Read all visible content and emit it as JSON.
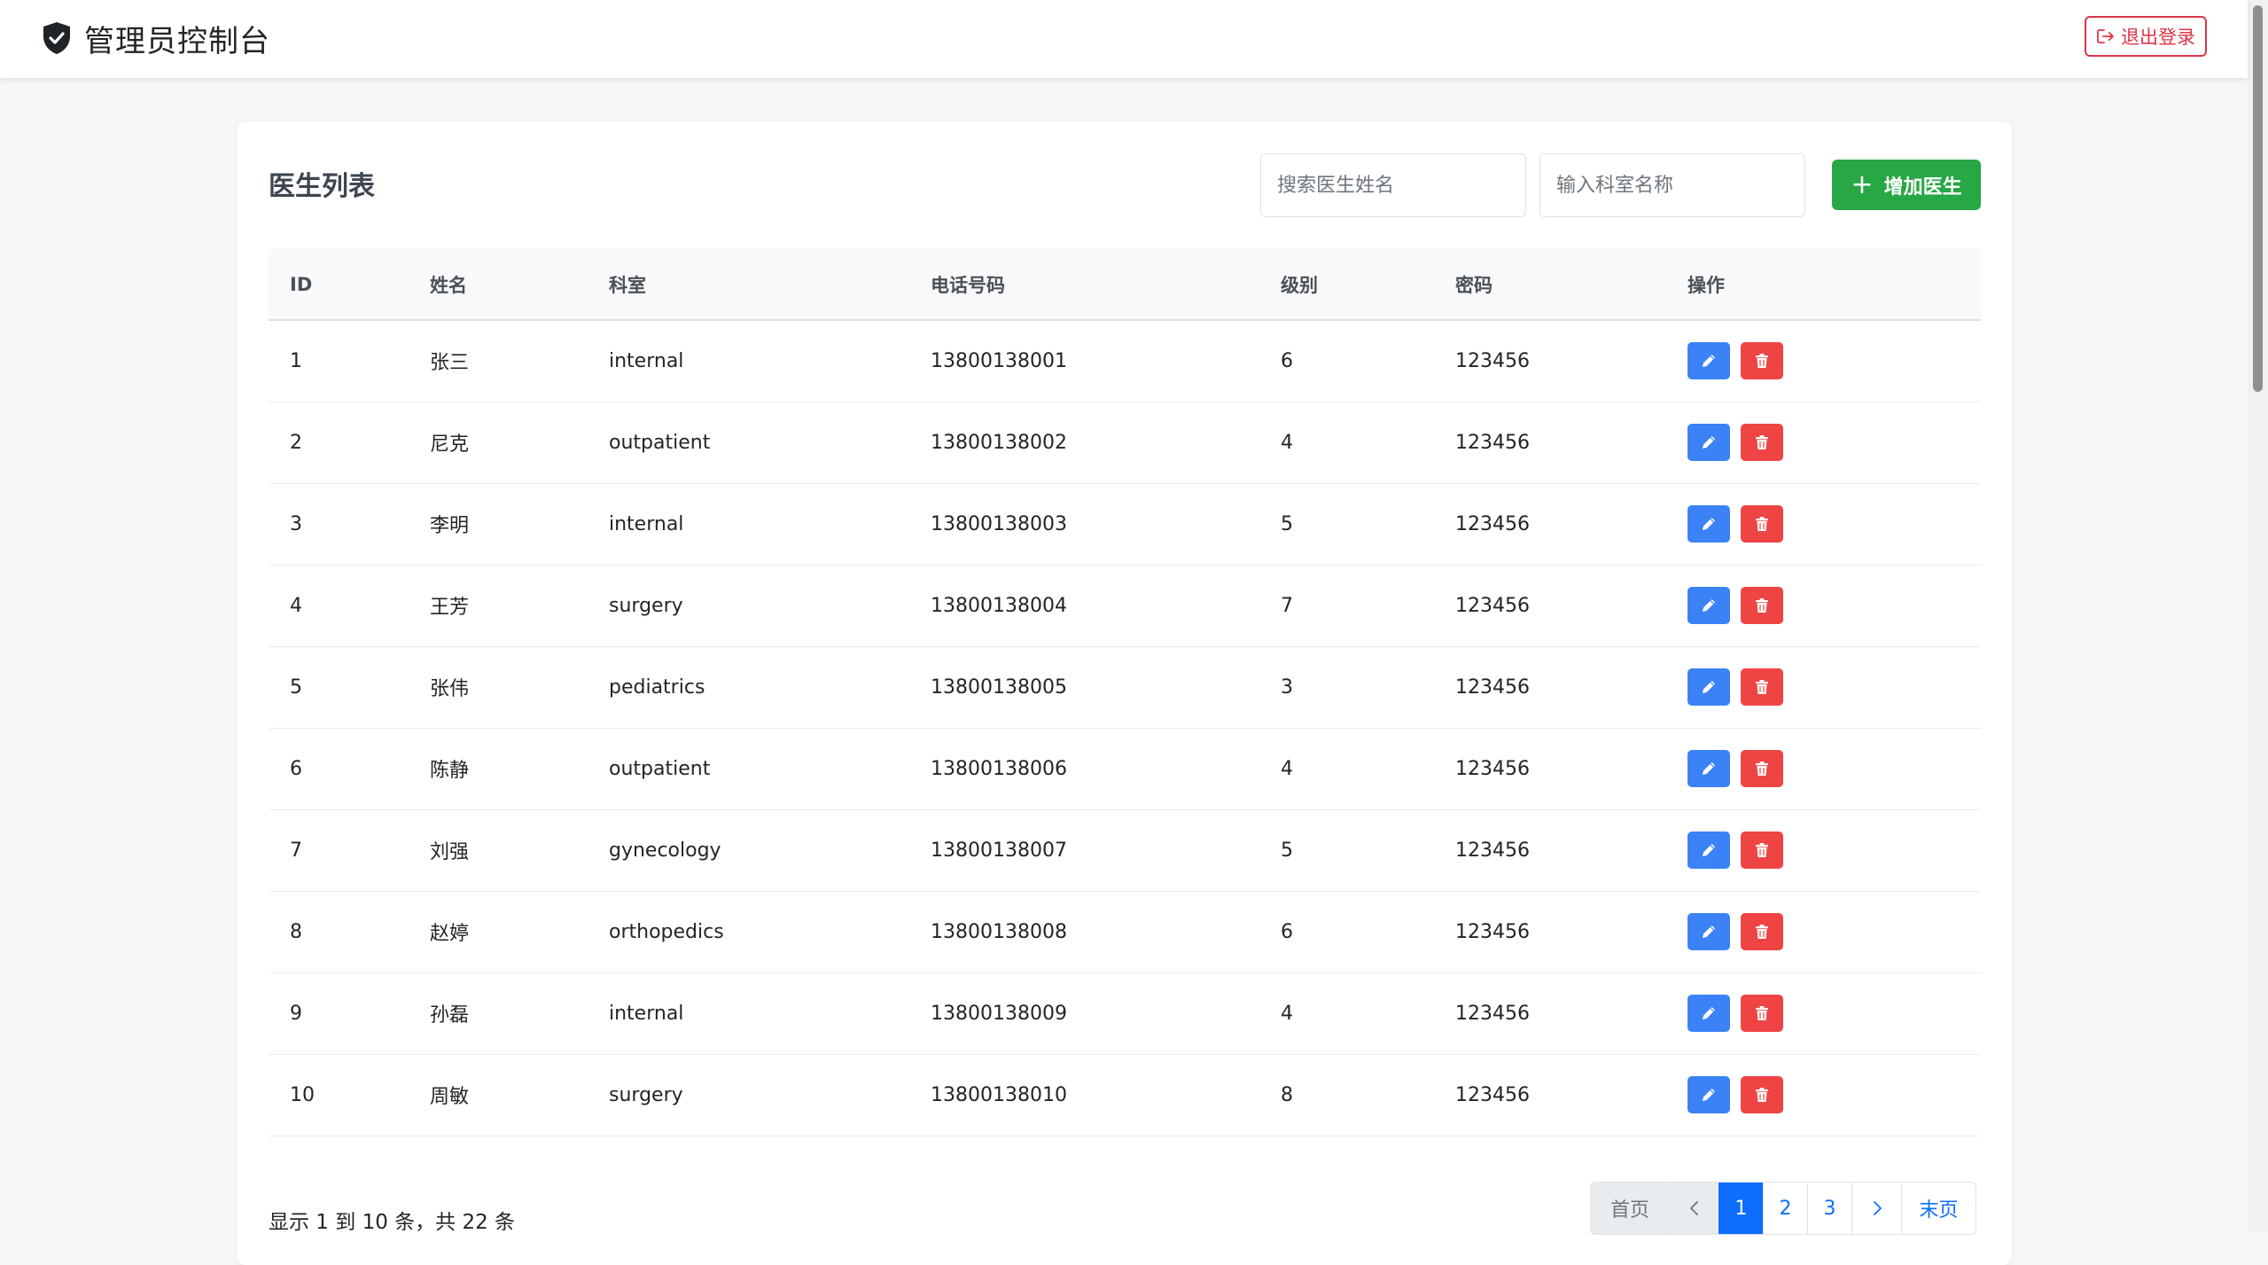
{
  "app": {
    "title": "管理员控制台",
    "logout_label": "退出登录"
  },
  "card": {
    "title": "医生列表",
    "search_name_placeholder": "搜索医生姓名",
    "search_dept_placeholder": "输入科室名称",
    "add_button_label": "增加医生"
  },
  "table": {
    "headers": [
      "ID",
      "姓名",
      "科室",
      "电话号码",
      "级别",
      "密码",
      "操作"
    ],
    "rows": [
      {
        "id": "1",
        "name": "张三",
        "dept": "internal",
        "phone": "13800138001",
        "level": "6",
        "password": "123456"
      },
      {
        "id": "2",
        "name": "尼克",
        "dept": "outpatient",
        "phone": "13800138002",
        "level": "4",
        "password": "123456"
      },
      {
        "id": "3",
        "name": "李明",
        "dept": "internal",
        "phone": "13800138003",
        "level": "5",
        "password": "123456"
      },
      {
        "id": "4",
        "name": "王芳",
        "dept": "surgery",
        "phone": "13800138004",
        "level": "7",
        "password": "123456"
      },
      {
        "id": "5",
        "name": "张伟",
        "dept": "pediatrics",
        "phone": "13800138005",
        "level": "3",
        "password": "123456"
      },
      {
        "id": "6",
        "name": "陈静",
        "dept": "outpatient",
        "phone": "13800138006",
        "level": "4",
        "password": "123456"
      },
      {
        "id": "7",
        "name": "刘强",
        "dept": "gynecology",
        "phone": "13800138007",
        "level": "5",
        "password": "123456"
      },
      {
        "id": "8",
        "name": "赵婷",
        "dept": "orthopedics",
        "phone": "13800138008",
        "level": "6",
        "password": "123456"
      },
      {
        "id": "9",
        "name": "孙磊",
        "dept": "internal",
        "phone": "13800138009",
        "level": "4",
        "password": "123456"
      },
      {
        "id": "10",
        "name": "周敏",
        "dept": "surgery",
        "phone": "13800138010",
        "level": "8",
        "password": "123456"
      }
    ]
  },
  "footer": {
    "summary": "显示 1 到 10 条，共 22 条",
    "pagination": {
      "first": "首页",
      "pages": [
        "1",
        "2",
        "3"
      ],
      "active_page": "1",
      "last": "末页"
    }
  },
  "icons": {
    "brand": "shield-check-icon",
    "logout": "box-arrow-right-icon",
    "add": "plus-icon",
    "edit": "pencil-icon",
    "delete": "trash-icon",
    "prev": "chevron-left-icon",
    "next": "chevron-right-icon"
  },
  "colors": {
    "primary": "#0d6efd",
    "success": "#28a745",
    "danger": "#dc3545",
    "edit_button": "#3b82f6",
    "delete_button": "#ef4444"
  }
}
